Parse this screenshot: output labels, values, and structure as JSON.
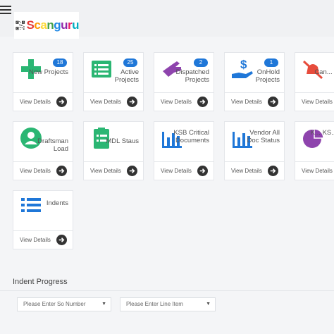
{
  "app": {
    "logo_text": [
      "S",
      "c",
      "a",
      "n",
      "g",
      "u",
      "r",
      "u"
    ]
  },
  "cards": [
    {
      "id": "new-projects",
      "title": "New Projects",
      "badge": "18",
      "footer": "View Details",
      "icon": "plus-icon",
      "color": "#2bb673"
    },
    {
      "id": "active-projects",
      "title": "Active Projects",
      "badge": "25",
      "footer": "View Details",
      "icon": "list-icon",
      "color": "#2bb673"
    },
    {
      "id": "dispatched-projects",
      "title": "Dispatched Projects",
      "badge": "2",
      "footer": "View Details",
      "icon": "hand-pointer-icon",
      "color": "#8e44ad"
    },
    {
      "id": "onhold-projects",
      "title": "OnHold Projects",
      "badge": "1",
      "footer": "View Details",
      "icon": "money-hand-icon",
      "color": "#1f77d8"
    },
    {
      "id": "cancelled-projects",
      "title": "Can... Pro...",
      "badge": "",
      "footer": "View Details",
      "icon": "bell-slash-icon",
      "color": "#e74c3c"
    },
    {
      "id": "draftsman-load",
      "title": "Draftsman Load",
      "badge": "",
      "footer": "View Details",
      "icon": "user-circle-icon",
      "color": "#2bb673"
    },
    {
      "id": "mdl-status",
      "title": "MDL Staus",
      "badge": "",
      "footer": "View Details",
      "icon": "clipboard-icon",
      "color": "#2bb673"
    },
    {
      "id": "ksb-critical",
      "title": "KSB Critical Documents",
      "badge": "",
      "footer": "View Details",
      "icon": "bar-chart-icon",
      "color": "#1f77d8"
    },
    {
      "id": "vendor-doc",
      "title": "Vendor All Doc Status",
      "badge": "",
      "footer": "View Details",
      "icon": "bar-chart-icon",
      "color": "#1f77d8"
    },
    {
      "id": "ksb-view",
      "title": "K... KS... Vi... D...",
      "badge": "",
      "footer": "View Details",
      "icon": "pie-chart-icon",
      "color": "#8e44ad"
    },
    {
      "id": "indents",
      "title": "Indents",
      "badge": "",
      "footer": "View Details",
      "icon": "list-bullets-icon",
      "color": "#1f77d8"
    }
  ],
  "indent_progress": {
    "title": "Indent Progress",
    "so_placeholder": "Please Enter So Number",
    "line_placeholder": "Please Enter Line Item"
  }
}
